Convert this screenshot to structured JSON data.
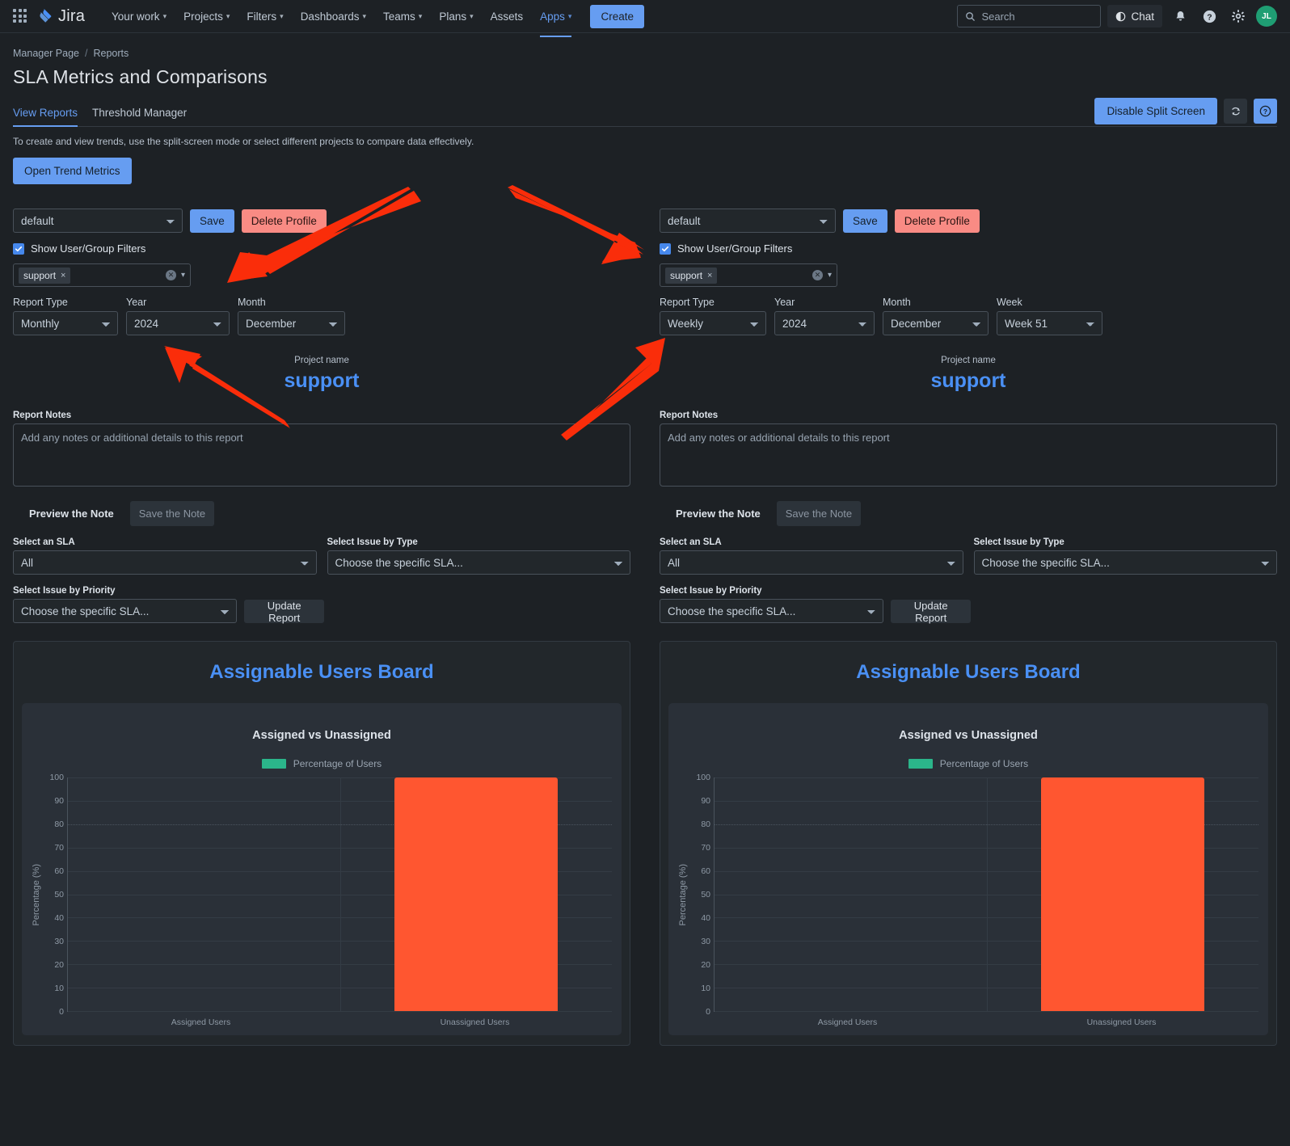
{
  "nav": {
    "brand": "Jira",
    "items": [
      {
        "label": "Your work",
        "has_caret": true,
        "active": false
      },
      {
        "label": "Projects",
        "has_caret": true,
        "active": false
      },
      {
        "label": "Filters",
        "has_caret": true,
        "active": false
      },
      {
        "label": "Dashboards",
        "has_caret": true,
        "active": false
      },
      {
        "label": "Teams",
        "has_caret": true,
        "active": false
      },
      {
        "label": "Plans",
        "has_caret": true,
        "active": false
      },
      {
        "label": "Assets",
        "has_caret": false,
        "active": false
      },
      {
        "label": "Apps",
        "has_caret": true,
        "active": true
      }
    ],
    "create_label": "Create",
    "search_placeholder": "Search",
    "chat_label": "Chat",
    "avatar_initials": "JL"
  },
  "header": {
    "breadcrumb": [
      "Manager Page",
      "Reports"
    ],
    "breadcrumb_sep": "/",
    "title": "SLA Metrics and Comparisons",
    "split_screen_label": "Disable Split Screen"
  },
  "tabs": [
    {
      "label": "View Reports",
      "active": true
    },
    {
      "label": "Threshold Manager",
      "active": false
    }
  ],
  "subtext": "To create and view trends, use the split-screen mode or select different projects to compare data effectively.",
  "trend_button": "Open Trend Metrics",
  "labels": {
    "report_type": "Report Type",
    "year": "Year",
    "month": "Month",
    "week": "Week",
    "show_filters": "Show User/Group Filters",
    "save": "Save",
    "delete_profile": "Delete Profile",
    "project_name": "Project name",
    "report_notes": "Report Notes",
    "notes_placeholder": "Add any notes or additional details to this report",
    "preview_note": "Preview the Note",
    "save_note": "Save the Note",
    "select_sla": "Select an SLA",
    "select_issue_type": "Select Issue by Type",
    "select_issue_priority": "Select Issue by Priority",
    "update_report": "Update Report",
    "sla_placeholder": "Choose the specific SLA...",
    "tag_value": "support"
  },
  "left_panel": {
    "profile": "default",
    "report_type": "Monthly",
    "year": "2024",
    "month": "December",
    "project_name": "support",
    "sla_value": "All",
    "issue_type_value": "Choose the specific SLA...",
    "issue_priority_value": "Choose the specific SLA..."
  },
  "right_panel": {
    "profile": "default",
    "report_type": "Weekly",
    "year": "2024",
    "month": "December",
    "week": "Week 51",
    "project_name": "support",
    "sla_value": "All",
    "issue_type_value": "Choose the specific SLA...",
    "issue_priority_value": "Choose the specific SLA..."
  },
  "colors": {
    "accent_blue": "#4a90f5",
    "bar_orange": "#ff5630",
    "legend_green": "#2bb58a",
    "danger": "#f98b84",
    "arrow_red": "#fa2d0a"
  },
  "chart_data": [
    {
      "type": "bar",
      "panel": "left",
      "board_title": "Assignable Users Board",
      "title": "Assigned vs Unassigned",
      "legend": [
        "Percentage of Users"
      ],
      "legend_position": "top",
      "categories": [
        "Assigned Users",
        "Unassigned Users"
      ],
      "values": [
        0,
        100
      ],
      "xlabel": "",
      "ylabel": "Percentage (%)",
      "ylim": [
        0,
        100
      ],
      "yticks": [
        0,
        10,
        20,
        30,
        40,
        50,
        60,
        70,
        80,
        90,
        100
      ],
      "grid": true
    },
    {
      "type": "bar",
      "panel": "right",
      "board_title": "Assignable Users Board",
      "title": "Assigned vs Unassigned",
      "legend": [
        "Percentage of Users"
      ],
      "legend_position": "top",
      "categories": [
        "Assigned Users",
        "Unassigned Users"
      ],
      "values": [
        0,
        100
      ],
      "xlabel": "",
      "ylabel": "Percentage (%)",
      "ylim": [
        0,
        100
      ],
      "yticks": [
        0,
        10,
        20,
        30,
        40,
        50,
        60,
        70,
        80,
        90,
        100
      ],
      "grid": true
    }
  ]
}
